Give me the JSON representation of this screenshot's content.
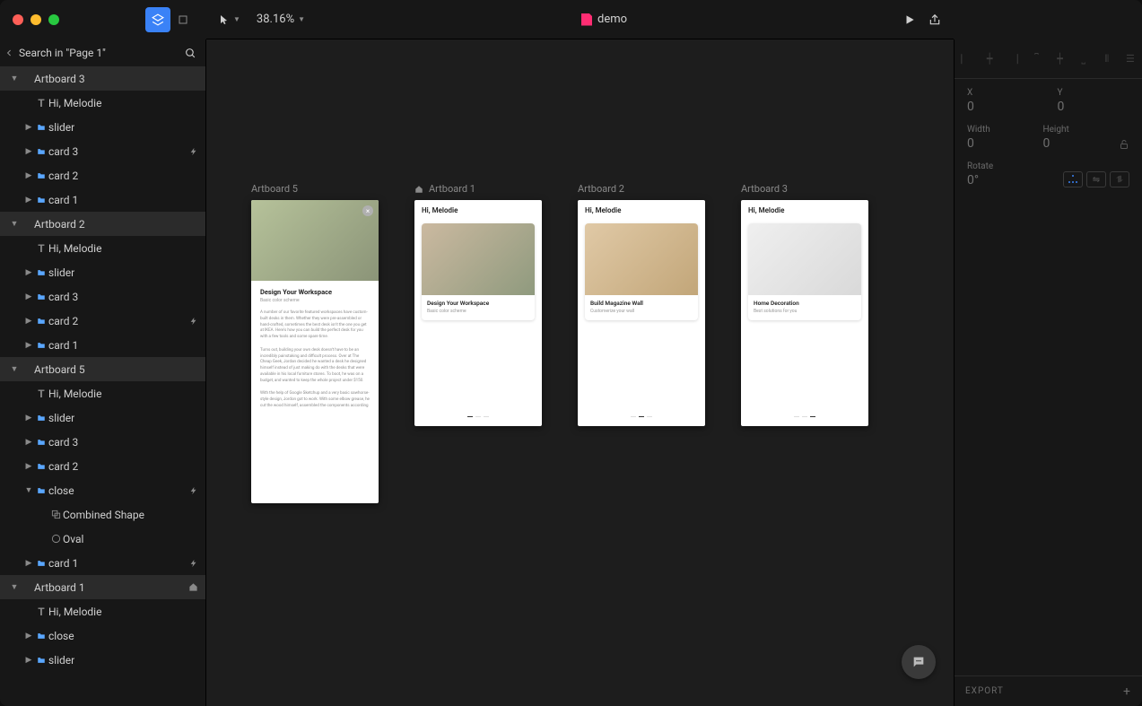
{
  "window": {
    "doc_name": "demo",
    "zoom": "38.16%"
  },
  "search": {
    "placeholder": "Search in \"Page 1\""
  },
  "layers": [
    {
      "kind": "artboard",
      "label": "Artboard 3",
      "depth": 0,
      "open": true
    },
    {
      "kind": "text",
      "label": "Hi, Melodie",
      "depth": 1
    },
    {
      "kind": "folder",
      "label": "slider",
      "depth": 1
    },
    {
      "kind": "folder",
      "label": "card 3",
      "depth": 1,
      "trailing": "bolt"
    },
    {
      "kind": "folder",
      "label": "card 2",
      "depth": 1
    },
    {
      "kind": "folder",
      "label": "card 1",
      "depth": 1
    },
    {
      "kind": "artboard",
      "label": "Artboard 2",
      "depth": 0,
      "open": true
    },
    {
      "kind": "text",
      "label": "Hi, Melodie",
      "depth": 1
    },
    {
      "kind": "folder",
      "label": "slider",
      "depth": 1
    },
    {
      "kind": "folder",
      "label": "card 3",
      "depth": 1
    },
    {
      "kind": "folder",
      "label": "card 2",
      "depth": 1,
      "trailing": "bolt"
    },
    {
      "kind": "folder",
      "label": "card 1",
      "depth": 1
    },
    {
      "kind": "artboard",
      "label": "Artboard 5",
      "depth": 0,
      "open": true
    },
    {
      "kind": "text",
      "label": "Hi, Melodie",
      "depth": 1
    },
    {
      "kind": "folder",
      "label": "slider",
      "depth": 1
    },
    {
      "kind": "folder",
      "label": "card 3",
      "depth": 1
    },
    {
      "kind": "folder",
      "label": "card 2",
      "depth": 1
    },
    {
      "kind": "folder",
      "label": "close",
      "depth": 1,
      "open": true,
      "trailing": "bolt"
    },
    {
      "kind": "shape",
      "label": "Combined Shape",
      "depth": 2
    },
    {
      "kind": "oval",
      "label": "Oval",
      "depth": 2
    },
    {
      "kind": "folder",
      "label": "card 1",
      "depth": 1,
      "trailing": "bolt"
    },
    {
      "kind": "artboard",
      "label": "Artboard 1",
      "depth": 0,
      "open": true,
      "trailing": "home"
    },
    {
      "kind": "text",
      "label": "Hi, Melodie",
      "depth": 1
    },
    {
      "kind": "folder",
      "label": "close",
      "depth": 1
    },
    {
      "kind": "folder",
      "label": "slider",
      "depth": 1
    }
  ],
  "artboards": [
    {
      "name": "Artboard 5",
      "tall": true,
      "detail": {
        "title": "Design Your Workspace",
        "subtitle": "Basic color scheme",
        "paragraphs": [
          "A number of our favorite featured workspaces have custom-built desks in them. Whether they were pre-assembled or hand-crafted, sometimes the best desk isn't the one you get at IKEA. Here's how you can build the perfect desk for you with a few tools and some spare time.",
          "Turns out, building your own desk doesn't have to be an incredibly painstaking and difficult process. Over at The Cheap Geek, Jordan decided he wanted a desk he designed himself instead of just making do with the desks that were available in his local furniture stores. To boot, he was on a budget, and wanted to keep the whole project under $150.",
          "With the help of Google Sketchup and a very basic sawhorse-style design, Jordon got to work. With some elbow grease, he cut the wood himself, assembled the components according"
        ]
      }
    },
    {
      "name": "Artboard 1",
      "home": true,
      "greeting": "Hi, Melodie",
      "card": {
        "title": "Design Your Workspace",
        "subtitle": "Basic color scheme",
        "variant": "a"
      }
    },
    {
      "name": "Artboard 2",
      "greeting": "Hi, Melodie",
      "card": {
        "title": "Build Magazine Wall",
        "subtitle": "Customerize your wall",
        "variant": "b"
      }
    },
    {
      "name": "Artboard 3",
      "greeting": "Hi, Melodie",
      "card": {
        "title": "Home Decoration",
        "subtitle": "Best solutions for you",
        "variant": "c"
      }
    }
  ],
  "inspector": {
    "x_label": "X",
    "x": "0",
    "y_label": "Y",
    "y": "0",
    "w_label": "Width",
    "w": "0",
    "h_label": "Height",
    "h": "0",
    "rotate_label": "Rotate",
    "rotate": "0°",
    "export_label": "EXPORT"
  }
}
